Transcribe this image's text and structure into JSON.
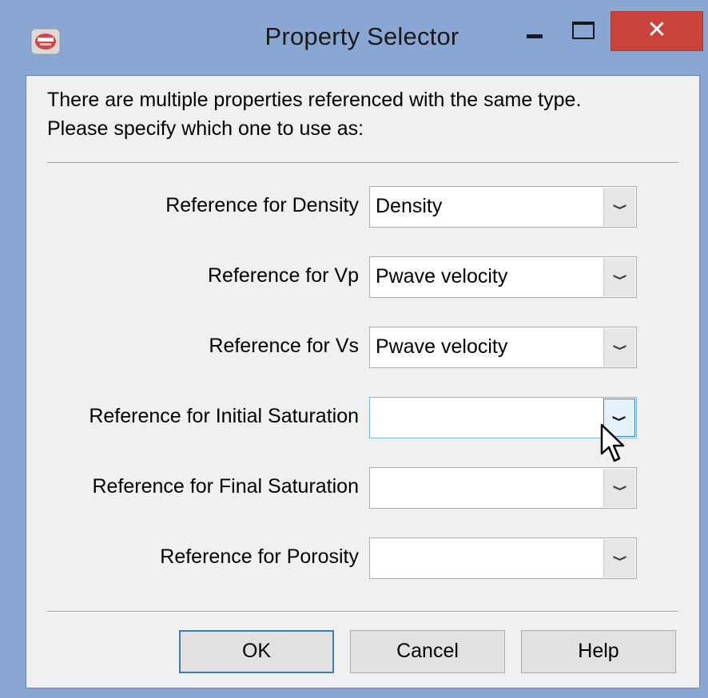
{
  "window": {
    "title": "Property Selector",
    "close_glyph": "✕",
    "icons": {
      "app": "app-icon",
      "minimize": "minimize-icon",
      "maximize": "maximize-icon",
      "close": "close-icon"
    }
  },
  "message": {
    "line1": "There are multiple properties referenced with the same type.",
    "line2": "Please specify which one to use as:"
  },
  "rows": [
    {
      "label": "Reference for Density",
      "value": "Density"
    },
    {
      "label": "Reference for Vp",
      "value": "Pwave velocity"
    },
    {
      "label": "Reference for Vs",
      "value": "Pwave velocity"
    },
    {
      "label": "Reference for Initial Saturation",
      "value": ""
    },
    {
      "label": "Reference for Final Saturation",
      "value": ""
    },
    {
      "label": "Reference for Porosity",
      "value": ""
    }
  ],
  "dropdown_arrow": "❯",
  "buttons": {
    "ok": "OK",
    "cancel": "Cancel",
    "help": "Help"
  },
  "colors": {
    "frame": "#8aa6d2",
    "close": "#c9433d",
    "client": "#f0f0f0",
    "focus": "#3c7fb1"
  }
}
